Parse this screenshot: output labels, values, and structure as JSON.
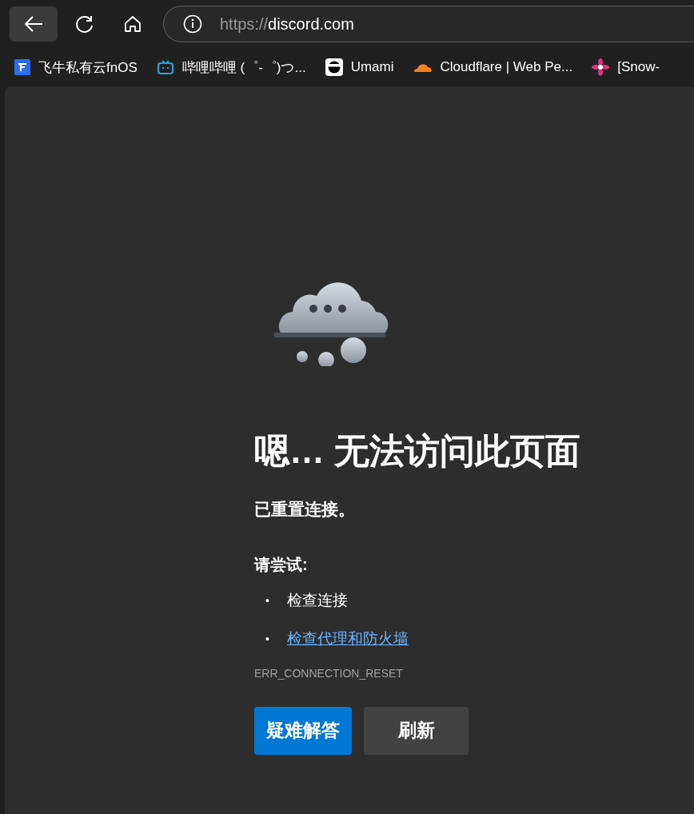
{
  "toolbar": {
    "url_scheme": "https://",
    "url_host": "discord.com"
  },
  "bookmarks": [
    {
      "label": "飞牛私有云fnOS"
    },
    {
      "label": "哔哩哔哩 (゜-゜)つ..."
    },
    {
      "label": "Umami"
    },
    {
      "label": "Cloudflare | Web Pe..."
    },
    {
      "label": "[Snow-"
    }
  ],
  "error": {
    "title": "嗯… 无法访问此页面",
    "subtitle": "已重置连接。",
    "try_heading": "请尝试:",
    "suggestions": [
      {
        "kind": "text",
        "bullet": "•",
        "label": "检查连接"
      },
      {
        "kind": "link",
        "bullet": "•",
        "label": "检查代理和防火墙"
      }
    ],
    "code": "ERR_CONNECTION_RESET",
    "buttons": [
      {
        "kind": "primary",
        "label": "疑难解答"
      },
      {
        "kind": "secondary",
        "label": "刷新"
      }
    ]
  }
}
